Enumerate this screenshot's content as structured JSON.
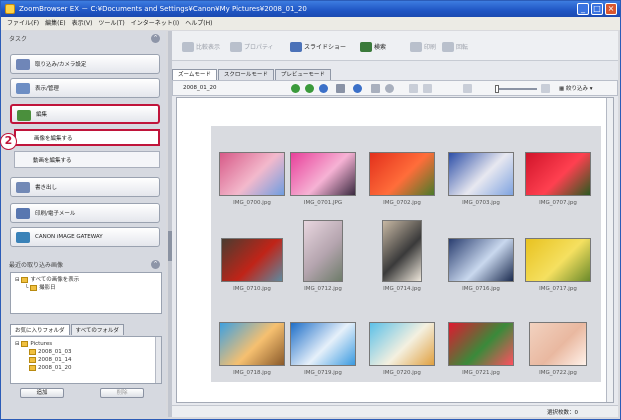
{
  "window": {
    "title": "ZoomBrowser EX － C:¥Documents and Settings¥Canon¥My Pictures¥2008_01_20"
  },
  "menu": [
    "ファイル(F)",
    "編集(E)",
    "表示(V)",
    "ツール(T)",
    "インターネット(I)",
    "ヘルプ(H)"
  ],
  "left": {
    "task_header": "タスク",
    "tasks": [
      {
        "label": "取り込み/カメラ設定",
        "color": "#6f86b8"
      },
      {
        "label": "表示/管理",
        "color": "#6d8ec4"
      },
      {
        "label": "編集",
        "color": "#4a8f3c"
      },
      {
        "label": "書き出し",
        "color": "#7289b6"
      },
      {
        "label": "印刷/電子メール",
        "color": "#5977b0"
      },
      {
        "label": "CANON iMAGE GATEWAY",
        "color": "#3a82b8"
      }
    ],
    "subtasks": [
      "画像を編集する",
      "動画を編集する"
    ],
    "callout": "2",
    "recent_header": "最近の取り込み画像",
    "recent_tree": [
      "すべての画像を表示",
      "撮影日"
    ],
    "folder_tabs": [
      "お気に入りフォルダ",
      "すべてのフォルダ"
    ],
    "folders": [
      "Pictures",
      "2008_01_03",
      "2008_01_14",
      "2008_01_20"
    ],
    "folder_buttons": [
      "追加",
      "削除"
    ]
  },
  "toolbar": {
    "items": [
      {
        "label": "比較表示",
        "disabled": true,
        "color": "#b9c0cc"
      },
      {
        "label": "プロパティ",
        "disabled": true,
        "color": "#b9c0cc"
      },
      {
        "label": "スライドショー",
        "disabled": false,
        "color": "#4b72b8"
      },
      {
        "label": "検索",
        "disabled": false,
        "color": "#3a7a3a"
      },
      {
        "label": "印刷",
        "disabled": true,
        "color": "#b9c0cc"
      },
      {
        "label": "回転",
        "disabled": true,
        "color": "#b9c0cc"
      }
    ]
  },
  "mode_tabs": [
    "ズームモード",
    "スクロールモード",
    "プレビューモード"
  ],
  "viewbar": {
    "date": "2008_01_20",
    "sort_label": "絞り込み"
  },
  "thumbnails": [
    {
      "file": "IMG_0700.jpg",
      "colors": [
        "#d75a88",
        "#f3b9cc",
        "#6f9de0"
      ]
    },
    {
      "file": "IMG_0701.JPG",
      "colors": [
        "#e8409a",
        "#f6b2d4",
        "#3a2a40"
      ]
    },
    {
      "file": "IMG_0702.jpg",
      "colors": [
        "#e2301c",
        "#ff6d3a",
        "#4a7a2a"
      ]
    },
    {
      "file": "IMG_0703.jpg",
      "colors": [
        "#2d4fa8",
        "#e8e8f0",
        "#7fa3e0"
      ]
    },
    {
      "file": "IMG_0707.jpg",
      "colors": [
        "#d0142a",
        "#ff4050",
        "#2a5a20"
      ]
    },
    {
      "file": "IMG_0710.jpg",
      "colors": [
        "#4a3c30",
        "#c02418",
        "#5e8aa0"
      ]
    },
    {
      "file": "IMG_0712.jpg",
      "colors": [
        "#e8d6df",
        "#b4a4ae",
        "#6e7c6a"
      ]
    },
    {
      "file": "IMG_0714.jpg",
      "colors": [
        "#c7b8a4",
        "#3a3a3a",
        "#efe8dc"
      ]
    },
    {
      "file": "IMG_0716.jpg",
      "colors": [
        "#2a3e70",
        "#c9d8ee",
        "#1c2c50"
      ]
    },
    {
      "file": "IMG_0717.jpg",
      "colors": [
        "#e8c220",
        "#f5e060",
        "#6a8a2a"
      ]
    },
    {
      "file": "IMG_0718.jpg",
      "colors": [
        "#3ea0e0",
        "#f6c070",
        "#8a5a2a"
      ]
    },
    {
      "file": "IMG_0719.jpg",
      "colors": [
        "#1f6fc8",
        "#e6f0fa",
        "#3a9ae0"
      ]
    },
    {
      "file": "IMG_0720.jpg",
      "colors": [
        "#5cc0e8",
        "#f4f0e0",
        "#e0a040"
      ]
    },
    {
      "file": "IMG_0721.jpg",
      "colors": [
        "#e01830",
        "#3a8a3a",
        "#ff5060"
      ]
    },
    {
      "file": "IMG_0722.jpg",
      "colors": [
        "#f2d2c0",
        "#e9b8a0",
        "#fff2ea"
      ]
    }
  ],
  "status": "選択枚数：0"
}
